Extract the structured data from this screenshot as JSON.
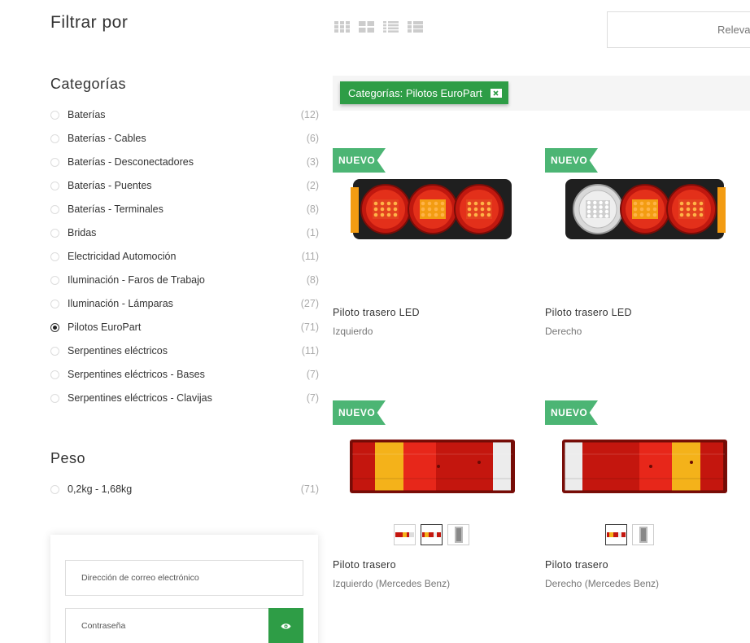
{
  "filters": {
    "title": "Filtrar por",
    "categories": {
      "title": "Categorías",
      "items": [
        {
          "label": "Baterías",
          "count": "(12)",
          "checked": false
        },
        {
          "label": "Baterías - Cables",
          "count": "(6)",
          "checked": false
        },
        {
          "label": "Baterías - Desconectadores",
          "count": "(3)",
          "checked": false
        },
        {
          "label": "Baterías - Puentes",
          "count": "(2)",
          "checked": false
        },
        {
          "label": "Baterías - Terminales",
          "count": "(8)",
          "checked": false
        },
        {
          "label": "Bridas",
          "count": "(1)",
          "checked": false
        },
        {
          "label": "Electricidad Automoción",
          "count": "(11)",
          "checked": false
        },
        {
          "label": "Iluminación - Faros de Trabajo",
          "count": "(8)",
          "checked": false
        },
        {
          "label": "Iluminación - Lámparas",
          "count": "(27)",
          "checked": false
        },
        {
          "label": "Pilotos EuroPart",
          "count": "(71)",
          "checked": true
        },
        {
          "label": "Serpentines eléctricos",
          "count": "(11)",
          "checked": false
        },
        {
          "label": "Serpentines eléctricos - Bases",
          "count": "(7)",
          "checked": false
        },
        {
          "label": "Serpentines eléctricos - Clavijas",
          "count": "(7)",
          "checked": false
        }
      ]
    },
    "weight": {
      "title": "Peso",
      "items": [
        {
          "label": "0,2kg - 1,68kg",
          "count": "(71)",
          "checked": false
        }
      ]
    }
  },
  "login": {
    "email_placeholder": "Dirección de correo electrónico",
    "password_placeholder": "Contraseña",
    "show_password_icon": "eye-icon"
  },
  "toolbar": {
    "view_icons": [
      "grid-small-icon",
      "grid-large-icon",
      "list-icon",
      "list-detail-icon"
    ],
    "sort_value": "Relevancia"
  },
  "active_filter": {
    "label": "Categorías: Pilotos EuroPart",
    "remove_icon": "close-icon"
  },
  "products": [
    {
      "badge": "NUEVO",
      "name": "Piloto trasero LED",
      "sub": "Izquierdo",
      "image": "led-tail-light-left",
      "swatches": 0
    },
    {
      "badge": "NUEVO",
      "name": "Piloto trasero LED",
      "sub": "Derecho",
      "image": "led-tail-light-right",
      "swatches": 0
    },
    {
      "badge": "NUEVO",
      "name": "Piloto trasero",
      "sub": "Izquierdo (Mercedes Benz)",
      "image": "tail-light-left",
      "swatches": 3
    },
    {
      "badge": "NUEVO",
      "name": "Piloto trasero",
      "sub": "Derecho (Mercedes Benz)",
      "image": "tail-light-right",
      "swatches": 2
    }
  ],
  "colors": {
    "accent_green": "#2e9d46",
    "badge_green": "#4cb574",
    "count_gray": "#aaaaaa"
  }
}
